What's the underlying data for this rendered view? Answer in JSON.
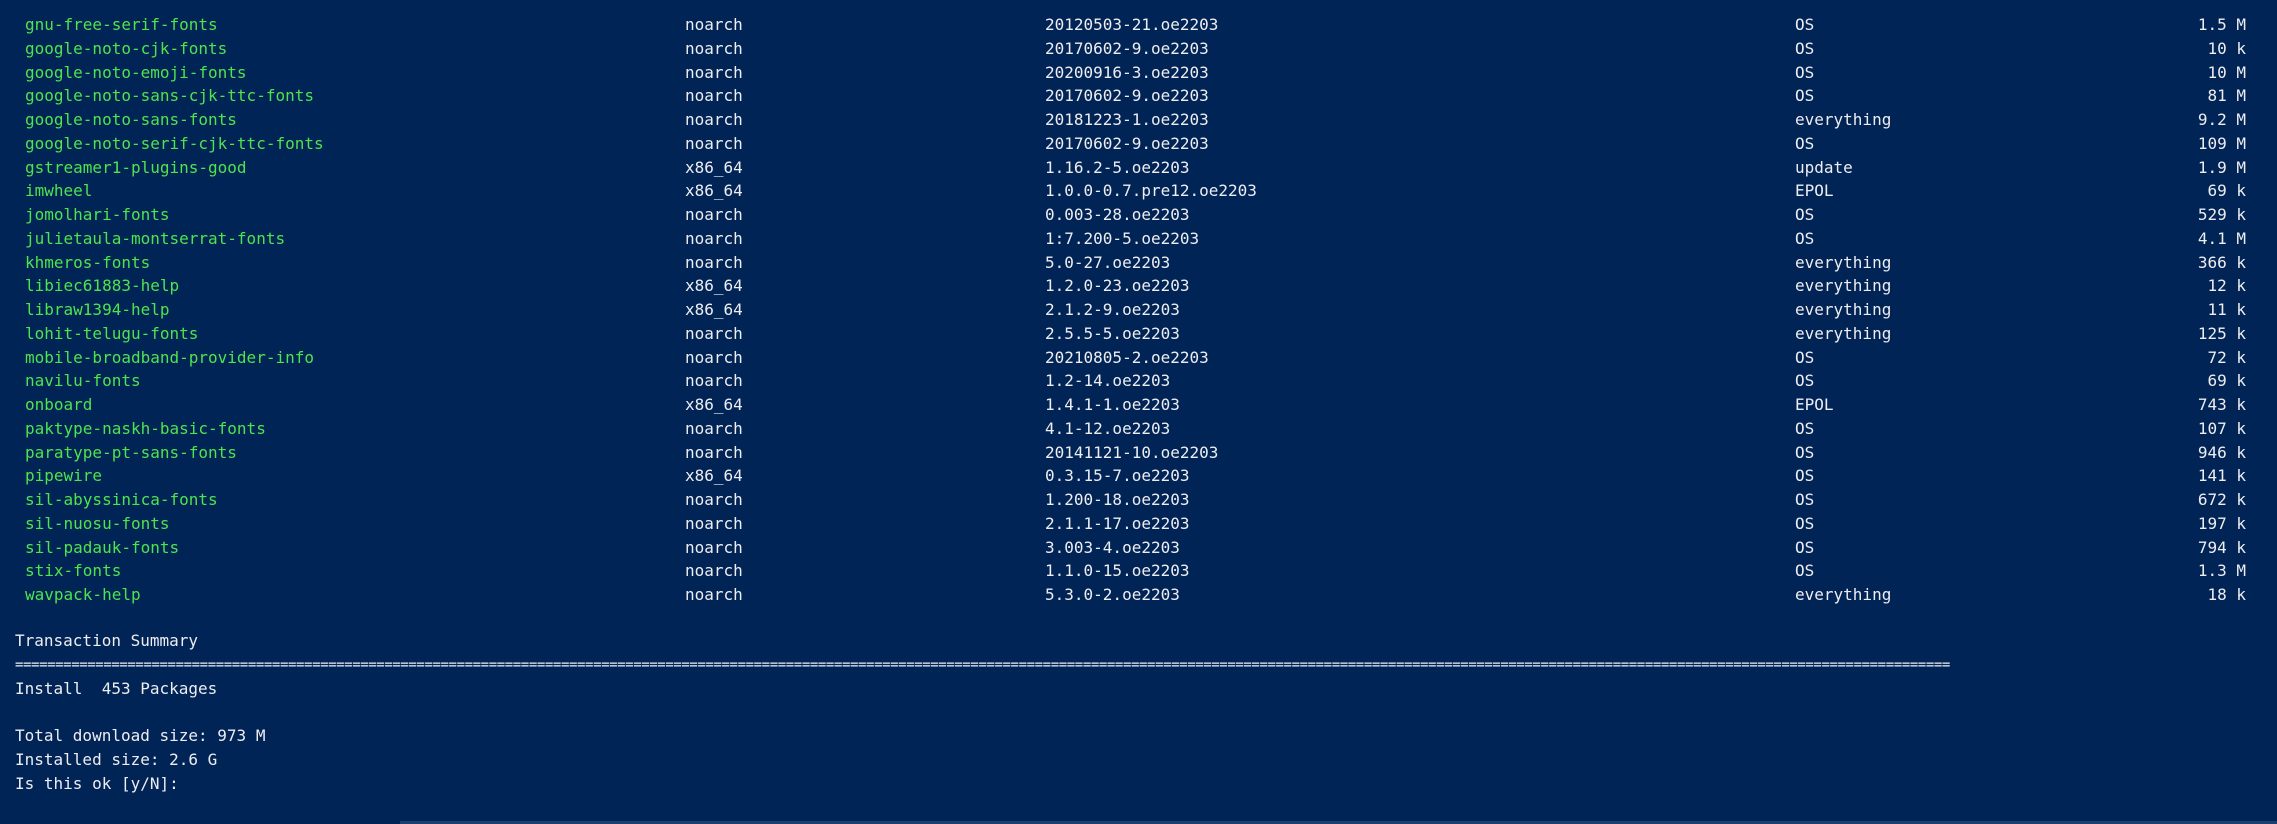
{
  "packages": [
    {
      "name": "gnu-free-serif-fonts",
      "arch": "noarch",
      "version": "20120503-21.oe2203",
      "repo": "OS",
      "size": "1.5 M"
    },
    {
      "name": "google-noto-cjk-fonts",
      "arch": "noarch",
      "version": "20170602-9.oe2203",
      "repo": "OS",
      "size": "10 k"
    },
    {
      "name": "google-noto-emoji-fonts",
      "arch": "noarch",
      "version": "20200916-3.oe2203",
      "repo": "OS",
      "size": "10 M"
    },
    {
      "name": "google-noto-sans-cjk-ttc-fonts",
      "arch": "noarch",
      "version": "20170602-9.oe2203",
      "repo": "OS",
      "size": "81 M"
    },
    {
      "name": "google-noto-sans-fonts",
      "arch": "noarch",
      "version": "20181223-1.oe2203",
      "repo": "everything",
      "size": "9.2 M"
    },
    {
      "name": "google-noto-serif-cjk-ttc-fonts",
      "arch": "noarch",
      "version": "20170602-9.oe2203",
      "repo": "OS",
      "size": "109 M"
    },
    {
      "name": "gstreamer1-plugins-good",
      "arch": "x86_64",
      "version": "1.16.2-5.oe2203",
      "repo": "update",
      "size": "1.9 M"
    },
    {
      "name": "imwheel",
      "arch": "x86_64",
      "version": "1.0.0-0.7.pre12.oe2203",
      "repo": "EPOL",
      "size": "69 k"
    },
    {
      "name": "jomolhari-fonts",
      "arch": "noarch",
      "version": "0.003-28.oe2203",
      "repo": "OS",
      "size": "529 k"
    },
    {
      "name": "julietaula-montserrat-fonts",
      "arch": "noarch",
      "version": "1:7.200-5.oe2203",
      "repo": "OS",
      "size": "4.1 M"
    },
    {
      "name": "khmeros-fonts",
      "arch": "noarch",
      "version": "5.0-27.oe2203",
      "repo": "everything",
      "size": "366 k"
    },
    {
      "name": "libiec61883-help",
      "arch": "x86_64",
      "version": "1.2.0-23.oe2203",
      "repo": "everything",
      "size": "12 k"
    },
    {
      "name": "libraw1394-help",
      "arch": "x86_64",
      "version": "2.1.2-9.oe2203",
      "repo": "everything",
      "size": "11 k"
    },
    {
      "name": "lohit-telugu-fonts",
      "arch": "noarch",
      "version": "2.5.5-5.oe2203",
      "repo": "everything",
      "size": "125 k"
    },
    {
      "name": "mobile-broadband-provider-info",
      "arch": "noarch",
      "version": "20210805-2.oe2203",
      "repo": "OS",
      "size": "72 k"
    },
    {
      "name": "navilu-fonts",
      "arch": "noarch",
      "version": "1.2-14.oe2203",
      "repo": "OS",
      "size": "69 k"
    },
    {
      "name": "onboard",
      "arch": "x86_64",
      "version": "1.4.1-1.oe2203",
      "repo": "EPOL",
      "size": "743 k"
    },
    {
      "name": "paktype-naskh-basic-fonts",
      "arch": "noarch",
      "version": "4.1-12.oe2203",
      "repo": "OS",
      "size": "107 k"
    },
    {
      "name": "paratype-pt-sans-fonts",
      "arch": "noarch",
      "version": "20141121-10.oe2203",
      "repo": "OS",
      "size": "946 k"
    },
    {
      "name": "pipewire",
      "arch": "x86_64",
      "version": "0.3.15-7.oe2203",
      "repo": "OS",
      "size": "141 k"
    },
    {
      "name": "sil-abyssinica-fonts",
      "arch": "noarch",
      "version": "1.200-18.oe2203",
      "repo": "OS",
      "size": "672 k"
    },
    {
      "name": "sil-nuosu-fonts",
      "arch": "noarch",
      "version": "2.1.1-17.oe2203",
      "repo": "OS",
      "size": "197 k"
    },
    {
      "name": "sil-padauk-fonts",
      "arch": "noarch",
      "version": "3.003-4.oe2203",
      "repo": "OS",
      "size": "794 k"
    },
    {
      "name": "stix-fonts",
      "arch": "noarch",
      "version": "1.1.0-15.oe2203",
      "repo": "OS",
      "size": "1.3 M"
    },
    {
      "name": "wavpack-help",
      "arch": "noarch",
      "version": "5.3.0-2.oe2203",
      "repo": "everything",
      "size": "18 k"
    }
  ],
  "summary": {
    "title": "Transaction Summary",
    "separator": "=================================================================================================================================================================================================================================================",
    "install_line": "Install  453 Packages",
    "download_line": "Total download size: 973 M",
    "installed_line": "Installed size: 2.6 G",
    "prompt": "Is this ok [y/N]:"
  },
  "colors": {
    "background": "#012456",
    "text": "#eeedf0",
    "package_name": "#4ee44e"
  }
}
